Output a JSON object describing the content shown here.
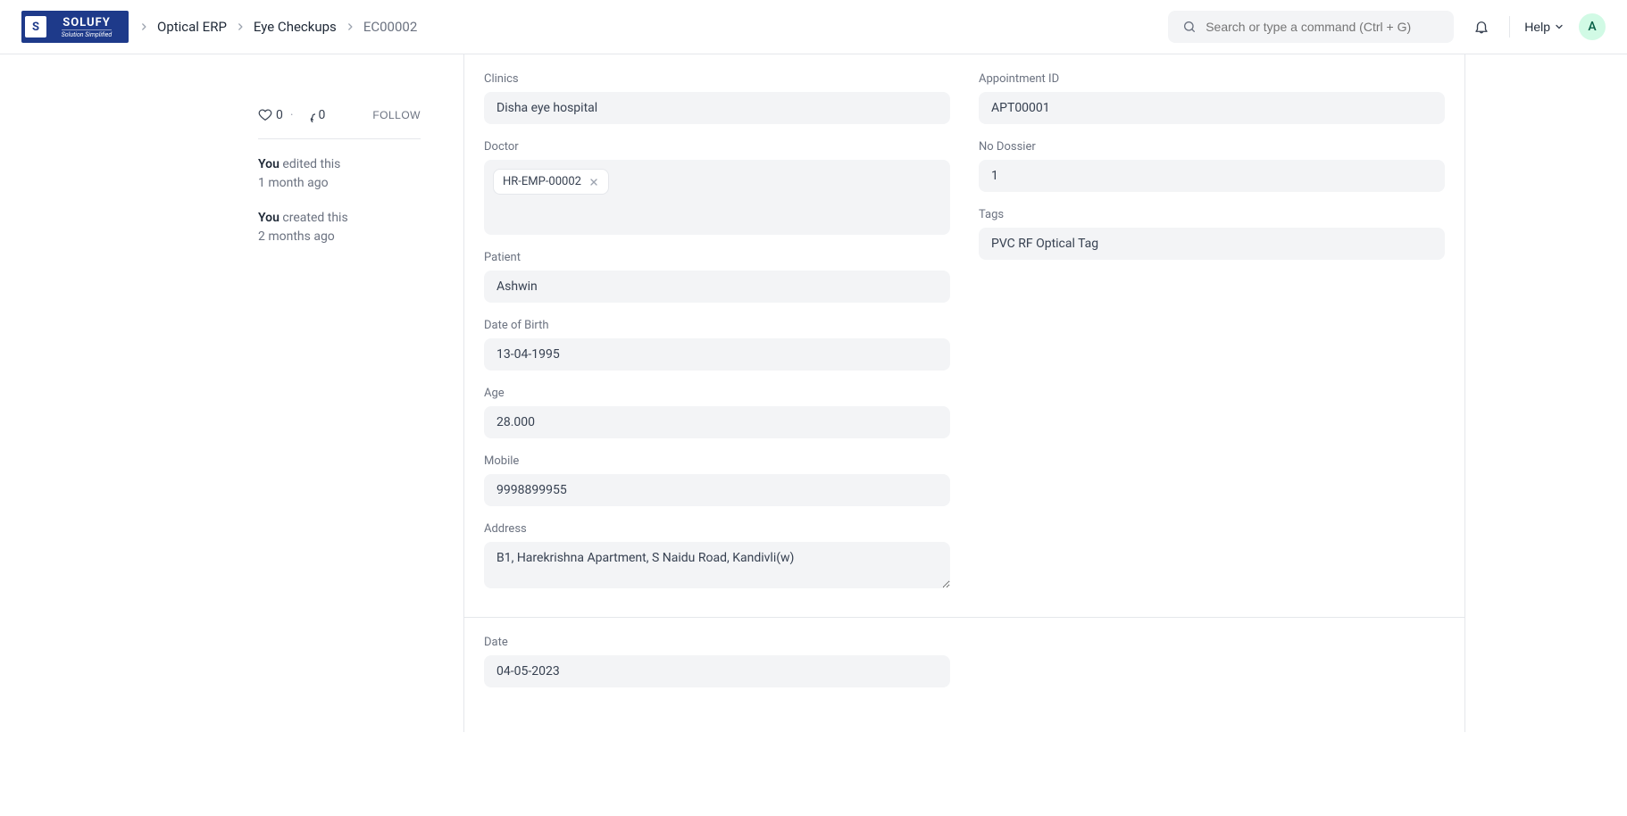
{
  "logo": {
    "main": "SOLUFY",
    "sub": "Solution Simplified",
    "mark": "S"
  },
  "breadcrumb": {
    "items": [
      {
        "label": "Optical ERP"
      },
      {
        "label": "Eye Checkups"
      }
    ],
    "current": "EC00002"
  },
  "search": {
    "placeholder": "Search or type a command (Ctrl + G)"
  },
  "help": {
    "label": "Help"
  },
  "avatar": {
    "initial": "A"
  },
  "sidebar": {
    "likes": "0",
    "comments": "0",
    "follow": "FOLLOW",
    "activity": [
      {
        "actor": "You",
        "action": "edited this",
        "time": "1 month ago"
      },
      {
        "actor": "You",
        "action": "created this",
        "time": "2 months ago"
      }
    ]
  },
  "form": {
    "clinics": {
      "label": "Clinics",
      "value": "Disha eye hospital"
    },
    "doctor": {
      "label": "Doctor",
      "chip": "HR-EMP-00002"
    },
    "patient": {
      "label": "Patient",
      "value": "Ashwin"
    },
    "dob": {
      "label": "Date of Birth",
      "value": "13-04-1995"
    },
    "age": {
      "label": "Age",
      "value": "28.000"
    },
    "mobile": {
      "label": "Mobile",
      "value": "9998899955"
    },
    "address": {
      "label": "Address",
      "value": "B1, Harekrishna Apartment, S Naidu Road, Kandivli(w)"
    },
    "date": {
      "label": "Date",
      "value": "04-05-2023"
    },
    "appointment": {
      "label": "Appointment ID",
      "value": "APT00001"
    },
    "dossier": {
      "label": "No Dossier",
      "value": "1"
    },
    "tags": {
      "label": "Tags",
      "value": "PVC RF Optical Tag"
    }
  }
}
